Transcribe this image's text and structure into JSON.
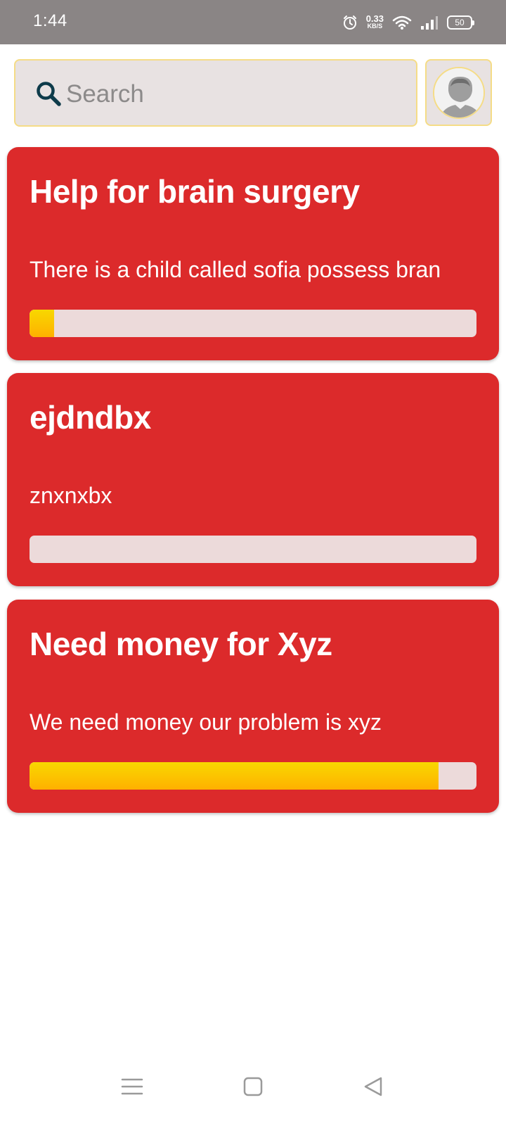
{
  "status_bar": {
    "time": "1:44",
    "net_speed_value": "0.33",
    "net_speed_unit": "KB/S",
    "battery": "50",
    "icons": [
      "alarm-icon",
      "wifi-icon",
      "signal-icon",
      "battery-icon"
    ]
  },
  "search": {
    "placeholder": "Search",
    "value": "",
    "icon": "search-icon"
  },
  "profile": {
    "icon": "avatar-icon"
  },
  "colors": {
    "status_bar": "#8a8585",
    "card": "#dc2a2b",
    "progress_track": "#ecdada",
    "progress_fill": "#ffc000",
    "search_border": "#f5dc86"
  },
  "cards": [
    {
      "title": "Help for brain surgery",
      "description": "There is a child called sofia possess bran",
      "progress": 0.055
    },
    {
      "title": "ejdndbx",
      "description": "znxnxbx",
      "progress": 0
    },
    {
      "title": "Need money for Xyz",
      "description": "We need money our problem is xyz",
      "progress": 0.915
    }
  ],
  "nav_bar": {
    "buttons": [
      "menu-icon",
      "home-icon",
      "back-icon"
    ]
  }
}
